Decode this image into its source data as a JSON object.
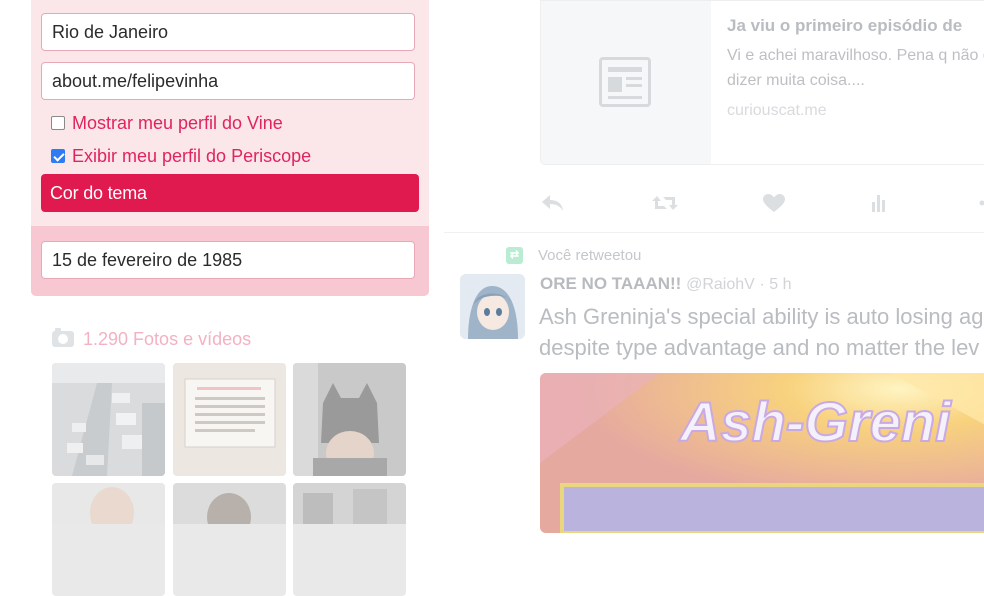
{
  "profile_form": {
    "location_value": "Rio de Janeiro",
    "website_value": "about.me/felipevinha",
    "vine_checkbox_label": "Mostrar meu perfil do Vine",
    "vine_checked": false,
    "periscope_checkbox_label": "Exibir meu perfil do Periscope",
    "periscope_checked": true,
    "theme_color_label": "Cor do tema",
    "theme_color": "#e0194e",
    "birthdate_value": "15 de fevereiro de 1985"
  },
  "photos": {
    "label": "1.290 Fotos e vídeos",
    "icon": "camera-icon",
    "thumbnails": [
      {
        "name": "photo-traffic"
      },
      {
        "name": "photo-sign"
      },
      {
        "name": "photo-batman"
      },
      {
        "name": "photo-person-1"
      },
      {
        "name": "photo-person-2"
      },
      {
        "name": "photo-person-3"
      }
    ]
  },
  "link_card": {
    "title": "Ja viu o primeiro episódio de",
    "description": "Vi e achei maravilhoso. Pena q não quer dizer muita coisa....",
    "domain": "curiouscat.me",
    "icon": "article-icon"
  },
  "tweet_actions": {
    "icons": [
      "reply-icon",
      "retweet-icon",
      "like-icon",
      "analytics-icon",
      "more-icon"
    ]
  },
  "retweet": {
    "context_label": "Você retweetou",
    "author_name": "ORE NO TAAAN!!",
    "author_handle": "@RaiohV",
    "time": "· 5 h",
    "text_line1": "Ash Greninja's special ability is auto losing ag",
    "text_line2": "despite type advantage and no matter the lev",
    "media_text": "Ash-Greni"
  },
  "colors": {
    "accent": "#e0245e",
    "panel_bg": "#fbe6ea",
    "muted_text": "#b9bcc0"
  }
}
